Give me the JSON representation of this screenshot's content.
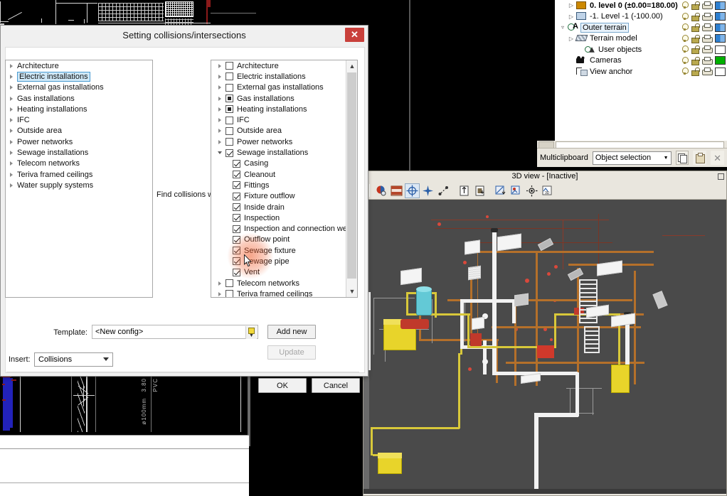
{
  "dialog": {
    "title": "Setting collisions/intersections",
    "close_label": "✕",
    "find_collisions_label": "Find collisions with",
    "template_label": "Template:",
    "template_value": "<New config>",
    "insert_label": "Insert:",
    "insert_value": "Collisions",
    "add_new_label": "Add new",
    "update_label": "Update",
    "ok_label": "OK",
    "cancel_label": "Cancel",
    "left_tree": [
      {
        "label": "Architecture",
        "selected": false
      },
      {
        "label": "Electric installations",
        "selected": true
      },
      {
        "label": "External gas installations",
        "selected": false
      },
      {
        "label": "Gas installations",
        "selected": false
      },
      {
        "label": "Heating installations",
        "selected": false
      },
      {
        "label": "IFC",
        "selected": false
      },
      {
        "label": "Outside area",
        "selected": false
      },
      {
        "label": "Power networks",
        "selected": false
      },
      {
        "label": "Sewage installations",
        "selected": false
      },
      {
        "label": "Telecom networks",
        "selected": false
      },
      {
        "label": "Teriva framed ceilings",
        "selected": false
      },
      {
        "label": "Water supply systems",
        "selected": false
      }
    ],
    "right_tree": [
      {
        "label": "Architecture",
        "state": "unchecked",
        "expander": "collapsed",
        "level": 0
      },
      {
        "label": "Electric installations",
        "state": "unchecked",
        "expander": "collapsed",
        "level": 0
      },
      {
        "label": "External gas installations",
        "state": "unchecked",
        "expander": "collapsed",
        "level": 0
      },
      {
        "label": "Gas installations",
        "state": "partial",
        "expander": "collapsed",
        "level": 0
      },
      {
        "label": "Heating installations",
        "state": "partial",
        "expander": "collapsed",
        "level": 0
      },
      {
        "label": "IFC",
        "state": "unchecked",
        "expander": "collapsed",
        "level": 0
      },
      {
        "label": "Outside area",
        "state": "unchecked",
        "expander": "collapsed",
        "level": 0
      },
      {
        "label": "Power networks",
        "state": "unchecked",
        "expander": "collapsed",
        "level": 0
      },
      {
        "label": "Sewage installations",
        "state": "checked",
        "expander": "expanded",
        "level": 0
      },
      {
        "label": "Casing",
        "state": "checked",
        "expander": "none",
        "level": 1
      },
      {
        "label": "Cleanout",
        "state": "checked",
        "expander": "none",
        "level": 1
      },
      {
        "label": "Fittings",
        "state": "checked",
        "expander": "none",
        "level": 1
      },
      {
        "label": "Fixture outflow",
        "state": "checked",
        "expander": "none",
        "level": 1
      },
      {
        "label": "Inside drain",
        "state": "checked",
        "expander": "none",
        "level": 1
      },
      {
        "label": "Inspection",
        "state": "checked",
        "expander": "none",
        "level": 1
      },
      {
        "label": "Inspection and connection well",
        "state": "checked",
        "expander": "none",
        "level": 1
      },
      {
        "label": "Outflow point",
        "state": "checked",
        "expander": "none",
        "level": 1
      },
      {
        "label": "Sewage fixture",
        "state": "checked",
        "expander": "none",
        "level": 1
      },
      {
        "label": "Sewage pipe",
        "state": "checked",
        "expander": "none",
        "level": 1
      },
      {
        "label": "Vent",
        "state": "checked",
        "expander": "none",
        "level": 1
      },
      {
        "label": "Telecom networks",
        "state": "unchecked",
        "expander": "collapsed",
        "level": 0
      },
      {
        "label": "Teriva framed ceilings",
        "state": "unchecked",
        "expander": "collapsed",
        "level": 0
      }
    ]
  },
  "project_tree": {
    "items": [
      {
        "label": "0. level 0 (±0.00=180.00)",
        "icon": "level-icon",
        "level": 1,
        "expander": "collapsed",
        "selected": false,
        "bold": true,
        "swatch": "partial"
      },
      {
        "label": "-1. Level -1 (-100.00)",
        "icon": "level-alt-icon",
        "level": 1,
        "expander": "collapsed",
        "selected": false,
        "bold": false,
        "swatch": "partial"
      },
      {
        "label": "Outer terrain",
        "icon": "outer-terrain-icon",
        "level": 0,
        "expander": "expanded",
        "selected": true,
        "bold": false,
        "swatch": "partial"
      },
      {
        "label": "Terrain model",
        "icon": "terrain-model-icon",
        "level": 1,
        "expander": "collapsed",
        "selected": false,
        "bold": false,
        "swatch": "partial"
      },
      {
        "label": "User objects",
        "icon": "user-objects-icon",
        "level": 2,
        "expander": "none",
        "selected": false,
        "bold": false,
        "swatch": "white"
      },
      {
        "label": "Cameras",
        "icon": "camera-icon",
        "level": 1,
        "expander": "none",
        "selected": false,
        "bold": false,
        "swatch": "green"
      },
      {
        "label": "View anchor",
        "icon": "view-anchor-icon",
        "level": 1,
        "expander": "none",
        "selected": false,
        "bold": false,
        "swatch": "white"
      }
    ]
  },
  "multiclipboard": {
    "label": "Multiclipboard",
    "selection_value": "Object selection",
    "copy_icon": "copy-icon",
    "paste_icon": "paste-icon",
    "delete_icon": "close-icon"
  },
  "view3d": {
    "title": "3D view - [Inactive]",
    "toolbar": [
      {
        "name": "render-settings-icon",
        "active": false
      },
      {
        "name": "wall-display-icon",
        "active": false
      },
      {
        "name": "orbit-icon",
        "active": true
      },
      {
        "name": "fly-through-icon",
        "active": false
      },
      {
        "name": "walk-path-icon",
        "active": false
      },
      {
        "name": "insert-camera-icon",
        "active": false
      },
      {
        "name": "insert-view-anchor-icon",
        "active": false
      },
      {
        "name": "export-view-icon",
        "active": false
      },
      {
        "name": "export-image-icon",
        "active": false
      },
      {
        "name": "sun-settings-icon",
        "active": false
      },
      {
        "name": "export-3d-icon",
        "active": false
      }
    ]
  },
  "cad": {
    "dim_label_1": "3.80",
    "dim_label_2": "ø100mm",
    "dim_label_3": "PVC"
  },
  "colors": {
    "accent": "#4a9bd1",
    "close_red": "#c9403b",
    "toolbar_bg": "#e9e6de",
    "glow": "#f05a28",
    "viewport_bg": "#4a4a4a"
  }
}
